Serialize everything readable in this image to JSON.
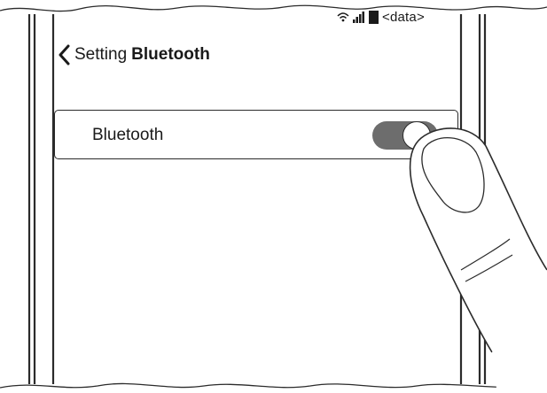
{
  "status_bar": {
    "carrier_text": "<data>",
    "wifi_icon": "wifi-icon",
    "signal_icon": "signal-bars-icon",
    "battery_icon": "battery-icon"
  },
  "nav": {
    "back_icon": "chevron-left-icon",
    "back_label": "Setting",
    "title": "Bluetooth"
  },
  "bluetooth_row": {
    "label": "Bluetooth",
    "toggle_state": "on"
  },
  "colors": {
    "toggle_on": "#6d6d6d",
    "line": "#2b2b2b"
  }
}
